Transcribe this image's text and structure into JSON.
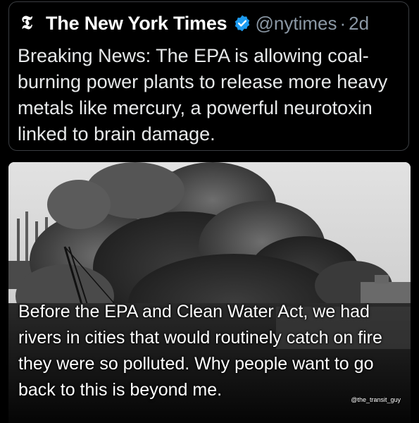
{
  "tweet": {
    "logo_glyph": "𝕿",
    "author_name": "The New York Times",
    "handle": "@nytimes",
    "separator": "·",
    "time": "2d",
    "verified_color": "#1d9bf0",
    "text": "Breaking News: The EPA is allowing coal-burning power plants to release more heavy metals like mercury, a powerful neurotoxin linked to brain damage."
  },
  "photo": {
    "caption": "Before the EPA and Clean Water Act, we had rivers in cities that would routinely catch on fire they were so polluted. Why people want to go back to this is beyond me.",
    "watermark": "@the_transit_guy"
  }
}
